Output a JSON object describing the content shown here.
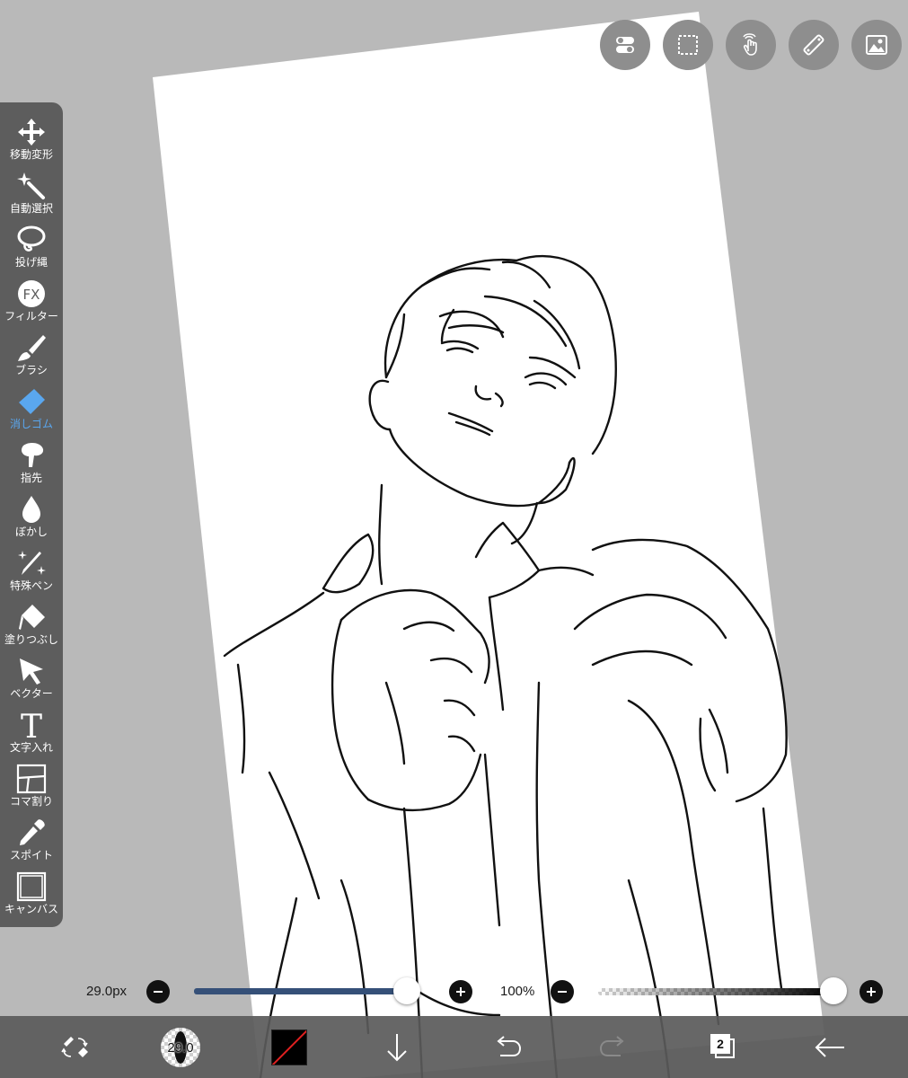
{
  "top_tools": [
    {
      "name": "toggle-icon"
    },
    {
      "name": "selection-icon"
    },
    {
      "name": "touch-gesture-icon"
    },
    {
      "name": "ruler-icon"
    },
    {
      "name": "material-image-icon"
    }
  ],
  "left_tools": [
    {
      "label": "移動変形",
      "icon": "move-transform-icon",
      "active": false
    },
    {
      "label": "自動選択",
      "icon": "magic-wand-icon",
      "active": false
    },
    {
      "label": "投げ縄",
      "icon": "lasso-icon",
      "active": false
    },
    {
      "label": "フィルター",
      "icon": "fx-filter-icon",
      "active": false
    },
    {
      "label": "ブラシ",
      "icon": "brush-icon",
      "active": false
    },
    {
      "label": "消しゴム",
      "icon": "eraser-icon",
      "active": true
    },
    {
      "label": "指先",
      "icon": "smudge-icon",
      "active": false
    },
    {
      "label": "ぼかし",
      "icon": "blur-drop-icon",
      "active": false
    },
    {
      "label": "特殊ペン",
      "icon": "special-pen-icon",
      "active": false
    },
    {
      "label": "塗りつぶし",
      "icon": "fill-bucket-icon",
      "active": false
    },
    {
      "label": "ベクター",
      "icon": "vector-arrow-icon",
      "active": false
    },
    {
      "label": "文字入れ",
      "icon": "text-icon",
      "active": false
    },
    {
      "label": "コマ割り",
      "icon": "frame-divider-icon",
      "active": false
    },
    {
      "label": "スポイト",
      "icon": "eyedropper-icon",
      "active": false
    },
    {
      "label": "キャンバス",
      "icon": "canvas-icon",
      "active": false
    }
  ],
  "sliders": {
    "brush_size_label": "29.0px",
    "brush_size_fraction": 0.97,
    "opacity_label": "100%",
    "opacity_fraction": 1.0
  },
  "bottom_bar": {
    "brush_size_value": "29.0",
    "current_color": "#000000",
    "layer_count": "2"
  },
  "colors": {
    "active_tool": "#5aa7ef",
    "panel_bg": "#5d5d5d",
    "workspace_bg": "#b9b9b9",
    "size_slider": "#355078"
  }
}
